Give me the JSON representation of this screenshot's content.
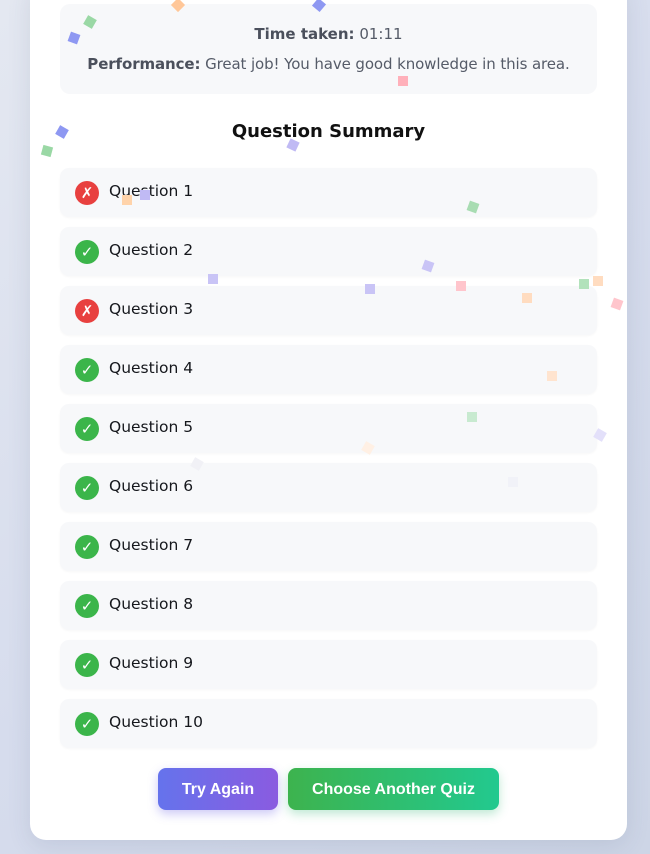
{
  "results": {
    "time_label": "Time taken:",
    "time_value": "01:11",
    "performance_label": "Performance:",
    "performance_value": "Great job! You have good knowledge in this area."
  },
  "summary": {
    "title": "Question Summary",
    "questions": [
      {
        "label": "Question 1",
        "status": "incorrect",
        "icon": "cross-icon"
      },
      {
        "label": "Question 2",
        "status": "correct",
        "icon": "check-icon"
      },
      {
        "label": "Question 3",
        "status": "incorrect",
        "icon": "cross-icon"
      },
      {
        "label": "Question 4",
        "status": "correct",
        "icon": "check-icon"
      },
      {
        "label": "Question 5",
        "status": "correct",
        "icon": "check-icon"
      },
      {
        "label": "Question 6",
        "status": "correct",
        "icon": "check-icon"
      },
      {
        "label": "Question 7",
        "status": "correct",
        "icon": "check-icon"
      },
      {
        "label": "Question 8",
        "status": "correct",
        "icon": "check-icon"
      },
      {
        "label": "Question 9",
        "status": "correct",
        "icon": "check-icon"
      },
      {
        "label": "Question 10",
        "status": "correct",
        "icon": "check-icon"
      }
    ]
  },
  "actions": {
    "try_again_label": "Try Again",
    "choose_another_label": "Choose Another Quiz"
  },
  "colors": {
    "correct": "#3bb54a",
    "incorrect": "#e8403f",
    "try_again_gradient": [
      "#6573ec",
      "#8a5be0"
    ],
    "choose_another_gradient": [
      "#3db34e",
      "#22c98f"
    ],
    "confetti": [
      "#6f7ff0",
      "#8fd69a",
      "#ffb37a",
      "#ff8f9f",
      "#b9b2f2"
    ]
  }
}
